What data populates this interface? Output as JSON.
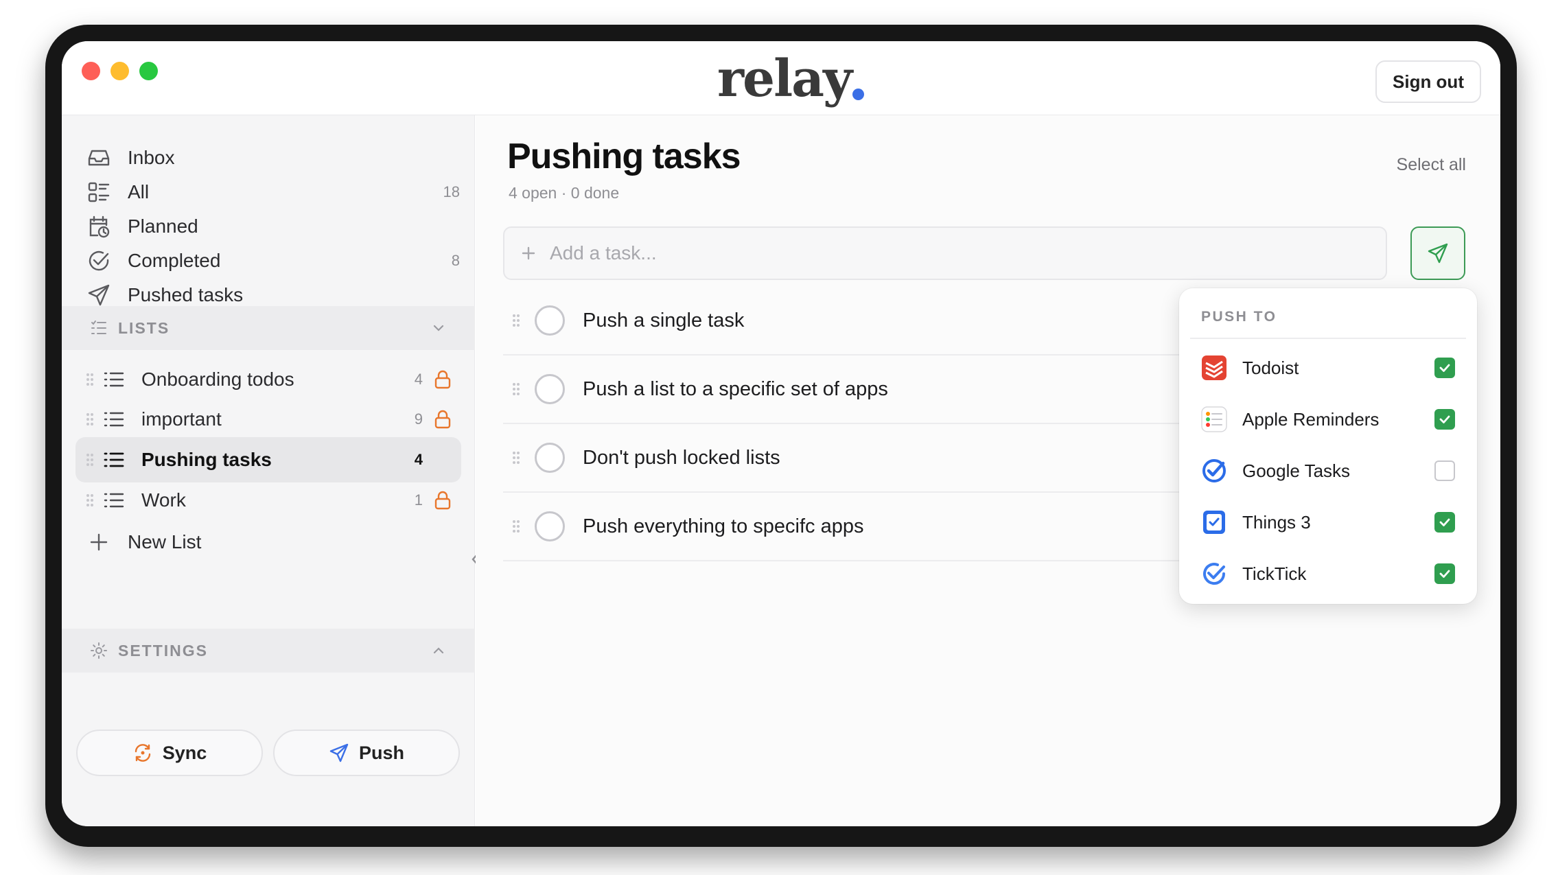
{
  "app": {
    "logo_text": "relay",
    "sign_out_label": "Sign out"
  },
  "sidebar": {
    "nav": [
      {
        "label": "Inbox",
        "count": "",
        "icon": "inbox-icon"
      },
      {
        "label": "All",
        "count": "18",
        "icon": "all-grid-icon"
      },
      {
        "label": "Planned",
        "count": "",
        "icon": "calendar-clock-icon"
      },
      {
        "label": "Completed",
        "count": "8",
        "icon": "check-circle-icon"
      },
      {
        "label": "Pushed tasks",
        "count": "",
        "icon": "paper-plane-icon"
      }
    ],
    "lists_header": "LISTS",
    "lists": [
      {
        "label": "Onboarding todos",
        "count": "4",
        "locked": true,
        "active": false
      },
      {
        "label": "important",
        "count": "9",
        "locked": true,
        "active": false
      },
      {
        "label": "Pushing tasks",
        "count": "4",
        "locked": false,
        "active": true
      },
      {
        "label": "Work",
        "count": "1",
        "locked": true,
        "active": false
      }
    ],
    "new_list_label": "New List",
    "settings_header": "SETTINGS",
    "sync_label": "Sync",
    "push_label": "Push"
  },
  "main": {
    "title": "Pushing tasks",
    "subtitle": "4 open · 0 done",
    "select_all_label": "Select all",
    "add_placeholder": "Add a task...",
    "tasks": [
      {
        "label": "Push a single task"
      },
      {
        "label": "Push a list to a specific set of apps"
      },
      {
        "label": "Don't push locked lists"
      },
      {
        "label": "Push everything to specifc apps"
      }
    ]
  },
  "push_menu": {
    "header": "PUSH TO",
    "apps": [
      {
        "label": "Todoist",
        "checked": true,
        "icon": "todoist-icon"
      },
      {
        "label": "Apple Reminders",
        "checked": true,
        "icon": "apple-reminders-icon"
      },
      {
        "label": "Google Tasks",
        "checked": false,
        "icon": "google-tasks-icon"
      },
      {
        "label": "Things 3",
        "checked": true,
        "icon": "things-icon"
      },
      {
        "label": "TickTick",
        "checked": true,
        "icon": "ticktick-icon"
      }
    ]
  },
  "colors": {
    "accent_green": "#2f9e4f",
    "lock_orange": "#e8762c",
    "logo_dot_blue": "#3b6fe6"
  }
}
